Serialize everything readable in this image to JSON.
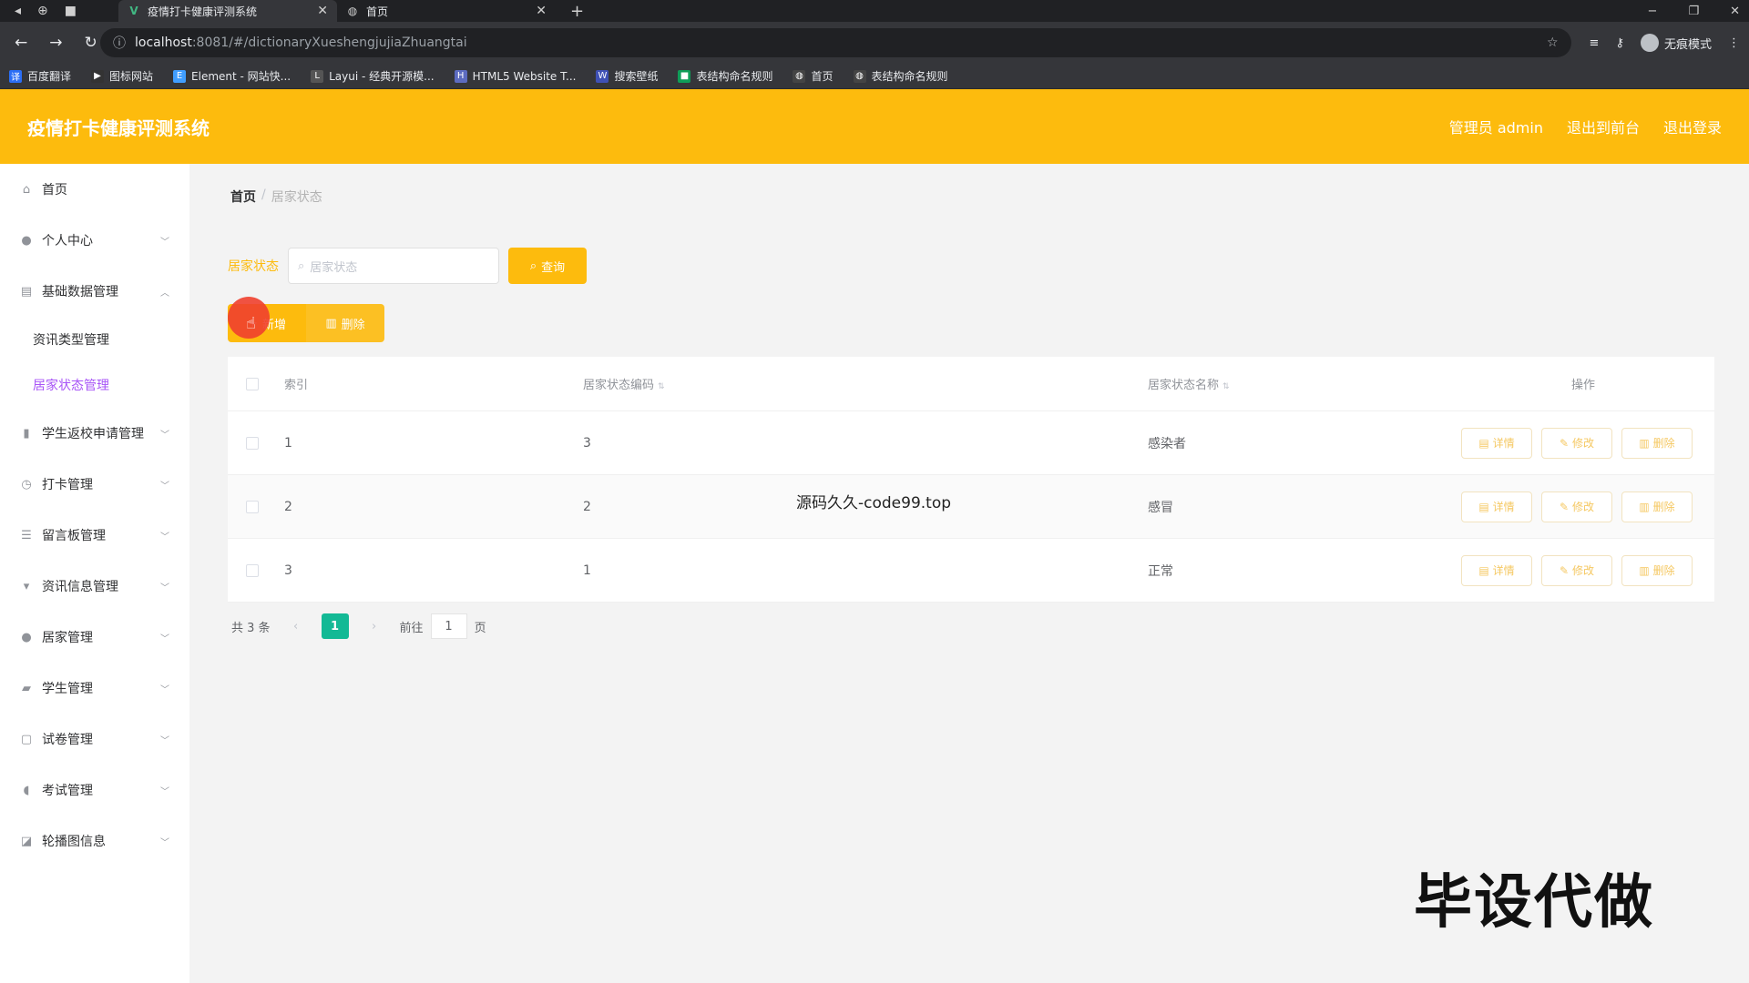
{
  "browser": {
    "nav_icons": [
      "◂",
      "⊕",
      "■"
    ],
    "tabs": [
      {
        "label": "疫情打卡健康评测系统",
        "icon": "vue-icon",
        "glyph": "V"
      },
      {
        "label": "首页",
        "icon": "globe-icon",
        "glyph": "◍"
      }
    ],
    "new_tab": "+",
    "window_controls": [
      "−",
      "❐",
      "✕"
    ],
    "address": {
      "host": "localhost",
      "path": ":8081/#/dictionaryXueshengjujiaZhuangtai"
    },
    "incognito_label": "无痕模式",
    "bookmarks": [
      {
        "label": "百度翻译",
        "color": "#2b6ef5",
        "glyph": "译"
      },
      {
        "label": "图标网站",
        "color": "#333333",
        "glyph": "▶"
      },
      {
        "label": "Element - 网站快...",
        "color": "#409eff",
        "glyph": "E"
      },
      {
        "label": "Layui - 经典开源模...",
        "color": "#555555",
        "glyph": "L"
      },
      {
        "label": "HTML5 Website T...",
        "color": "#5c6bc0",
        "glyph": "H"
      },
      {
        "label": "搜索壁纸",
        "color": "#3f51b5",
        "glyph": "W"
      },
      {
        "label": "表结构命名规则",
        "color": "#0f9d58",
        "glyph": "■"
      },
      {
        "label": "首页",
        "color": "#444444",
        "glyph": "◍"
      },
      {
        "label": "表结构命名规则",
        "color": "#444444",
        "glyph": "◍"
      }
    ]
  },
  "header": {
    "title": "疫情打卡健康评测系统",
    "admin": "管理员 admin",
    "front": "退出到前台",
    "logout": "退出登录"
  },
  "sidebar": {
    "items": [
      {
        "label": "首页",
        "icon": "home-icon",
        "glyph": "⌂"
      },
      {
        "label": "个人中心",
        "icon": "user-icon",
        "glyph": "●"
      },
      {
        "label": "基础数据管理",
        "icon": "database-icon",
        "glyph": "▤"
      },
      {
        "label": "学生返校申请管理",
        "icon": "bar-chart-icon",
        "glyph": "▮"
      },
      {
        "label": "打卡管理",
        "icon": "clock-icon",
        "glyph": "◷"
      },
      {
        "label": "留言板管理",
        "icon": "list-icon",
        "glyph": "☰"
      },
      {
        "label": "资讯信息管理",
        "icon": "message-icon",
        "glyph": "▾"
      },
      {
        "label": "居家管理",
        "icon": "user-icon",
        "glyph": "●"
      },
      {
        "label": "学生管理",
        "icon": "student-icon",
        "glyph": "▰"
      },
      {
        "label": "试卷管理",
        "icon": "document-icon",
        "glyph": "▢"
      },
      {
        "label": "考试管理",
        "icon": "microphone-icon",
        "glyph": "◖"
      },
      {
        "label": "轮播图信息",
        "icon": "picture-icon",
        "glyph": "◪"
      }
    ],
    "sub_items": [
      "资讯类型管理",
      "居家状态管理"
    ]
  },
  "breadcrumb": {
    "home": "首页",
    "sep": "/",
    "current": "居家状态"
  },
  "search": {
    "label": "居家状态",
    "placeholder": "居家状态",
    "button": "查询"
  },
  "actions": {
    "add": "新增",
    "delete": "删除"
  },
  "table": {
    "headers": {
      "index": "索引",
      "code": "居家状态编码",
      "name": "居家状态名称",
      "ops": "操作"
    },
    "rows": [
      {
        "index": "1",
        "code": "3",
        "name": "感染者"
      },
      {
        "index": "2",
        "code": "2",
        "name": "感冒"
      },
      {
        "index": "3",
        "code": "1",
        "name": "正常"
      }
    ],
    "row_buttons": {
      "detail": "详情",
      "edit": "修改",
      "delete": "删除"
    }
  },
  "pagination": {
    "total": "共 3 条",
    "prev": "‹",
    "current": "1",
    "next": "›",
    "goto": "前往",
    "goto_value": "1",
    "page_suffix": "页"
  },
  "overlay": {
    "source": "源码久久-code99.top",
    "banner": "毕设代做"
  },
  "colors": {
    "accent": "#fdbb0d",
    "active_menu": "#a855f7",
    "page_active": "#13b995"
  }
}
